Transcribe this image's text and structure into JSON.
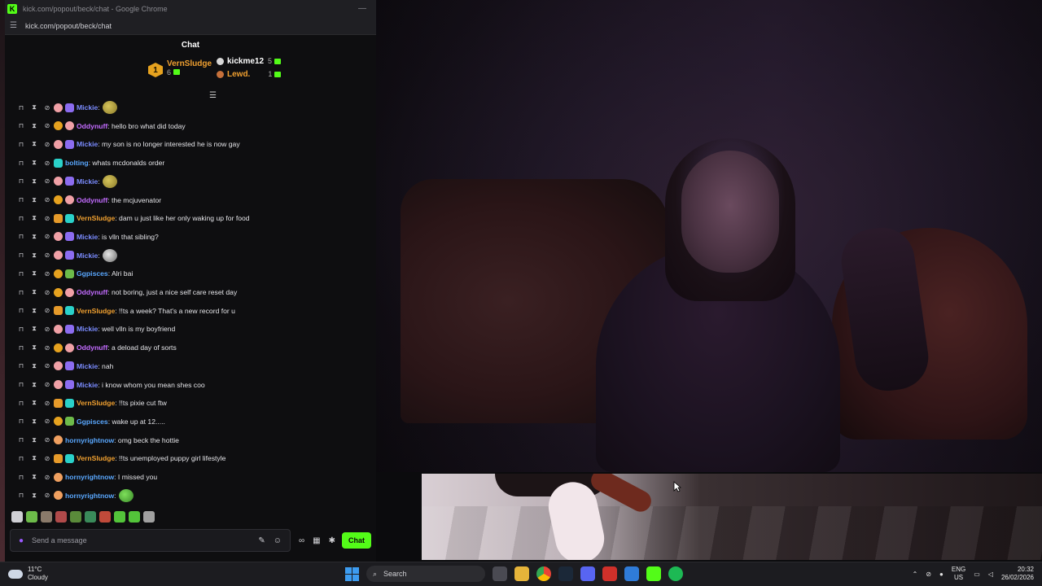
{
  "browser": {
    "title": "kick.com/popout/beck/chat - Google Chrome",
    "url": "kick.com/popout/beck/chat"
  },
  "chat": {
    "header": "Chat",
    "top_gifters": [
      {
        "rank": "1",
        "name": "VernSludge",
        "count": "6",
        "color": "#f0a030"
      },
      {
        "name": "kickme12",
        "count": "5",
        "color": "#ffffff"
      },
      {
        "name": "Lewd.",
        "count": "1",
        "color": "#f0a030"
      }
    ],
    "messages": [
      {
        "user": "Mickie",
        "color": "#7b8cff",
        "text": "",
        "emote": "pepe",
        "badges": [
          "b-pig",
          "b-gift"
        ]
      },
      {
        "user": "Oddynuff",
        "color": "#c36cff",
        "text": ": hello bro what did today",
        "badges": [
          "b-gold",
          "b-pig"
        ]
      },
      {
        "user": "Mickie",
        "color": "#7b8cff",
        "text": ": my son is no longer interested he is now gay",
        "badges": [
          "b-pig",
          "b-gift"
        ]
      },
      {
        "user": "bolting",
        "color": "#5aa8ff",
        "text": ": whats mcdonalds order",
        "badges": [
          "b-teal"
        ]
      },
      {
        "user": "Mickie",
        "color": "#7b8cff",
        "text": "",
        "emote": "pepe",
        "badges": [
          "b-pig",
          "b-gift"
        ]
      },
      {
        "user": "Oddynuff",
        "color": "#c36cff",
        "text": ": the mcjuvenator",
        "badges": [
          "b-gold",
          "b-pig"
        ]
      },
      {
        "user": "VernSludge",
        "color": "#f0a030",
        "text": ": dam u just like her only waking up for food",
        "badges": [
          "b-crown",
          "b-teal"
        ]
      },
      {
        "user": "Mickie",
        "color": "#7b8cff",
        "text": ": is vlln that sibling?",
        "badges": [
          "b-pig",
          "b-gift"
        ]
      },
      {
        "user": "Mickie",
        "color": "#7b8cff",
        "text": "",
        "emote": "ghost",
        "badges": [
          "b-pig",
          "b-gift"
        ]
      },
      {
        "user": "Ggpisces",
        "color": "#5aa8ff",
        "text": ": Alri bai",
        "badges": [
          "b-gold",
          "b-green"
        ]
      },
      {
        "user": "Oddynuff",
        "color": "#c36cff",
        "text": ": not boring, just a nice self care reset day",
        "badges": [
          "b-gold",
          "b-pig"
        ]
      },
      {
        "user": "VernSludge",
        "color": "#f0a030",
        "text": ": !!ts a week? That's a new record for u",
        "badges": [
          "b-crown",
          "b-teal"
        ]
      },
      {
        "user": "Mickie",
        "color": "#7b8cff",
        "text": ": well vlln is my boyfriend",
        "badges": [
          "b-pig",
          "b-gift"
        ]
      },
      {
        "user": "Oddynuff",
        "color": "#c36cff",
        "text": ": a deload day of sorts",
        "badges": [
          "b-gold",
          "b-pig"
        ]
      },
      {
        "user": "Mickie",
        "color": "#7b8cff",
        "text": ": nah",
        "badges": [
          "b-pig",
          "b-gift"
        ]
      },
      {
        "user": "Mickie",
        "color": "#7b8cff",
        "text": ": i know whom you mean shes coo",
        "badges": [
          "b-pig",
          "b-gift"
        ]
      },
      {
        "user": "VernSludge",
        "color": "#f0a030",
        "text": ": !!ts pixie cut ftw",
        "badges": [
          "b-crown",
          "b-teal"
        ]
      },
      {
        "user": "Ggpisces",
        "color": "#5aa8ff",
        "text": ": wake up at 12.....",
        "badges": [
          "b-gold",
          "b-green"
        ]
      },
      {
        "user": "hornyrightnow",
        "color": "#5aa8ff",
        "text": ": omg beck the hottie",
        "badges": [
          "b-orange"
        ]
      },
      {
        "user": "VernSludge",
        "color": "#f0a030",
        "text": ": !!ts unemployed puppy girl lifestyle",
        "badges": [
          "b-crown",
          "b-teal"
        ]
      },
      {
        "user": "hornyrightnow",
        "color": "#5aa8ff",
        "text": ": I missed you",
        "badges": [
          "b-orange"
        ]
      },
      {
        "user": "hornyrightnow",
        "color": "#5aa8ff",
        "text": "",
        "emote": "smile",
        "badges": [
          "b-orange"
        ]
      }
    ],
    "input_placeholder": "Send a message",
    "send_label": "Chat"
  },
  "taskbar": {
    "weather_temp": "11°C",
    "weather_desc": "Cloudy",
    "search_label": "Search",
    "lang_top": "ENG",
    "lang_bottom": "US",
    "time": "20:32",
    "date": "26/02/2026"
  },
  "colors": {
    "kick_green": "#53fc18",
    "accent_purple": "#9b59ff"
  }
}
